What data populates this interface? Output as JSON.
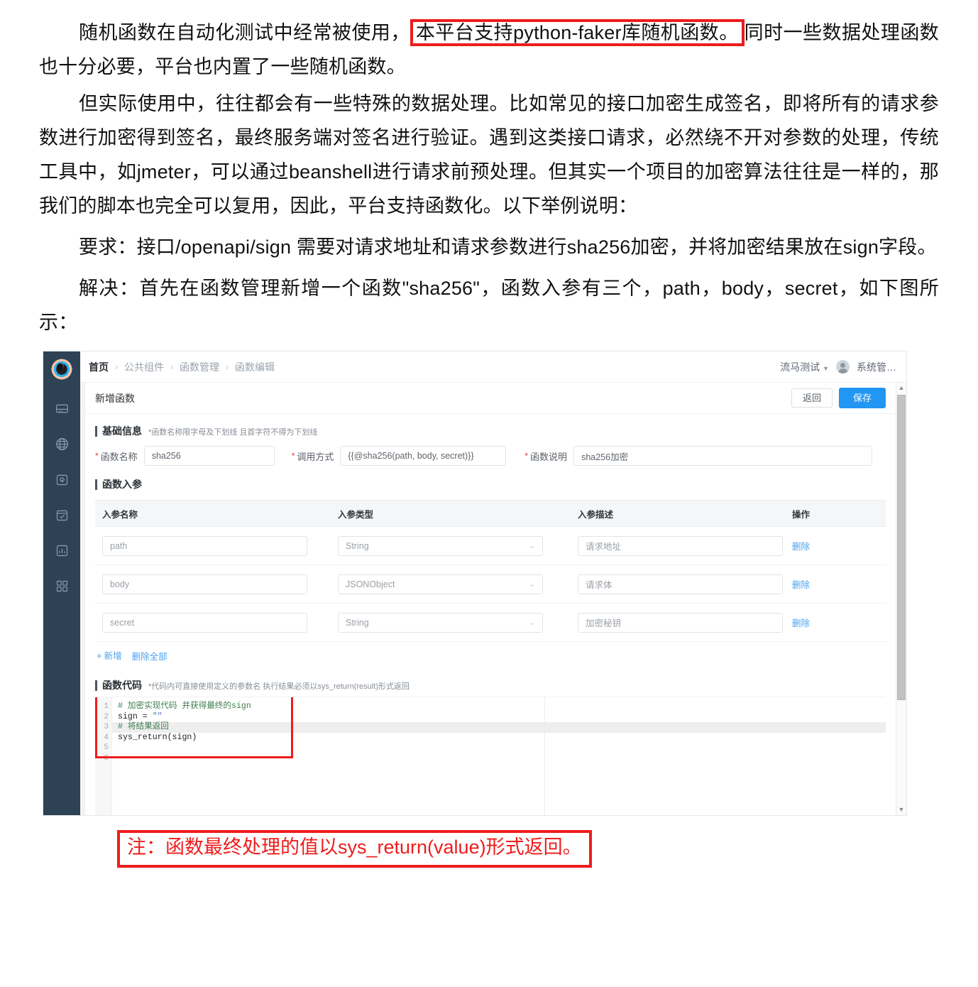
{
  "article": {
    "paragraphs": [
      {
        "id": "p1",
        "segments": [
          {
            "text": "随机函数在自动化测试中经常被使用，",
            "highlight": false
          },
          {
            "text": "本平台支持python-faker库随机函数。",
            "highlight": true
          },
          {
            "text": "同时一些数据处理函数也十分必要，平台也内置了一些随机函数。",
            "highlight": false
          }
        ]
      },
      {
        "id": "p2",
        "text": "但实际使用中，往往都会有一些特殊的数据处理。比如常见的接口加密生成签名，即将所有的请求参数进行加密得到签名，最终服务端对签名进行验证。遇到这类接口请求，必然绕不开对参数的处理，传统工具中，如jmeter，可以通过beanshell进行请求前预处理。但其实一个项目的加密算法往往是一样的，那我们的脚本也完全可以复用，因此，平台支持函数化。以下举例说明："
      },
      {
        "id": "p3",
        "text": "要求：接口/openapi/sign 需要对请求地址和请求参数进行sha256加密，并将加密结果放在sign字段。"
      },
      {
        "id": "p4",
        "text": "解决：首先在函数管理新增一个函数\"sha256\"，函数入参有三个，path，body，secret，如下图所示："
      }
    ]
  },
  "app": {
    "sidebar": {
      "logo_name": "app-logo",
      "items": [
        {
          "icon": "server-icon",
          "label": "服务"
        },
        {
          "icon": "globe-icon",
          "label": "全局"
        },
        {
          "icon": "box-lock-icon",
          "label": "资产"
        },
        {
          "icon": "calendar-check-icon",
          "label": "计划"
        },
        {
          "icon": "report-chart-icon",
          "label": "报表"
        },
        {
          "icon": "grid-apps-icon",
          "label": "应用"
        }
      ]
    },
    "topbar": {
      "breadcrumbs": [
        "首页",
        "公共组件",
        "函数管理",
        "函数编辑"
      ],
      "separator": "›",
      "project": "流马测试",
      "project_caret": "▼",
      "user": "系统管…"
    },
    "page": {
      "title": "新增函数",
      "back_label": "返回",
      "save_label": "保存"
    },
    "basic_info": {
      "section_title": "基础信息",
      "section_note": "*函数名称限字母及下划线 且首字符不得为下划线",
      "fields": [
        {
          "label": "函数名称",
          "value": "sha256",
          "required": "*"
        },
        {
          "label": "调用方式",
          "value": "{{@sha256(path, body, secret)}}",
          "required": "*"
        },
        {
          "label": "函数说明",
          "value": "sha256加密",
          "required": "*"
        }
      ]
    },
    "params": {
      "section_title": "函数入参",
      "columns": [
        "入参名称",
        "入参类型",
        "入参描述",
        "操作"
      ],
      "rows": [
        {
          "name": "path",
          "type": "String",
          "desc": "请求地址",
          "action": "删除"
        },
        {
          "name": "body",
          "type": "JSONObject",
          "desc": "请求体",
          "action": "删除"
        },
        {
          "name": "secret",
          "type": "String",
          "desc": "加密秘钥",
          "action": "删除"
        }
      ],
      "add_label": "新增",
      "add_plus": "+",
      "delete_all_label": "删除全部",
      "chevron": "⌄"
    },
    "code": {
      "section_title": "函数代码",
      "section_note": "*代码内可直接使用定义的参数名 执行结果必须以sys_return(result)形式返回",
      "lines": [
        {
          "no": "1",
          "parts": [
            {
              "t": "# 加密实现代码 并获得最终的sign",
              "c": "cmt"
            }
          ]
        },
        {
          "no": "2",
          "parts": [
            {
              "t": "sign = ",
              "c": ""
            },
            {
              "t": "\"\"",
              "c": "str"
            }
          ]
        },
        {
          "no": "3",
          "parts": [
            {
              "t": "# 将结果返回",
              "c": "cmt"
            }
          ],
          "highlight": true
        },
        {
          "no": "4",
          "parts": [
            {
              "t": "sys_return(sign)",
              "c": ""
            }
          ]
        },
        {
          "no": "5",
          "parts": [
            {
              "t": "",
              "c": ""
            }
          ]
        },
        {
          "no": "6",
          "parts": [
            {
              "t": "",
              "c": ""
            }
          ]
        }
      ]
    },
    "scrollbar": {
      "up": "▲",
      "down": "▼"
    }
  },
  "caption": {
    "text": "注：函数最终处理的值以sys_return(value)形式返回。",
    "color": "#ee1c1c"
  },
  "colors": {
    "sidebar_bg": "#2e4255",
    "primary": "#2396f3",
    "link": "#4aa3f0",
    "required": "#e4393c",
    "annotation_red": "#ee1c1c"
  }
}
